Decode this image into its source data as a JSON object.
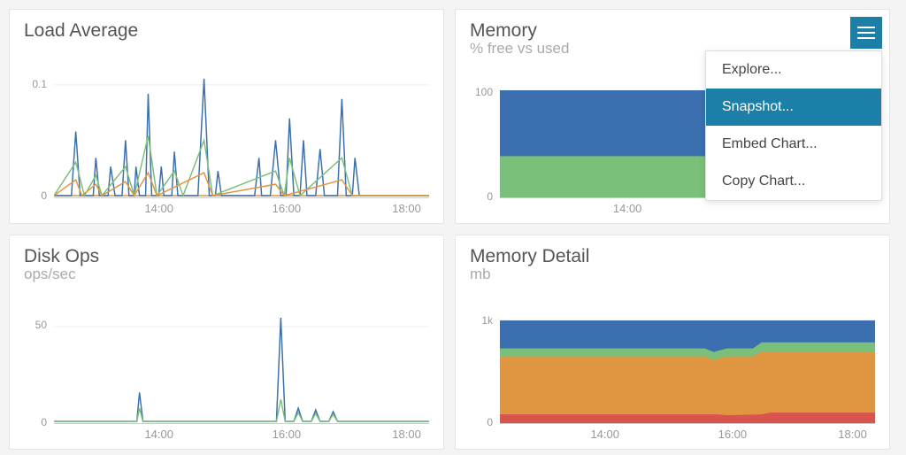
{
  "panels": {
    "load": {
      "title": "Load Average",
      "subtitle": ""
    },
    "memory": {
      "title": "Memory",
      "subtitle": "% free vs used"
    },
    "disk": {
      "title": "Disk Ops",
      "subtitle": "ops/sec"
    },
    "memdetail": {
      "title": "Memory Detail",
      "subtitle": "mb"
    }
  },
  "menu": {
    "items": [
      "Explore...",
      "Snapshot...",
      "Embed Chart...",
      "Copy Chart..."
    ],
    "selected": 1
  },
  "axes": {
    "load": {
      "y": [
        "0.1",
        "0"
      ],
      "x": [
        "14:00",
        "16:00",
        "18:00"
      ]
    },
    "memory": {
      "y": [
        "100",
        "0"
      ],
      "x": [
        "14:00"
      ]
    },
    "disk": {
      "y": [
        "50",
        "0"
      ],
      "x": [
        "14:00",
        "16:00",
        "18:00"
      ]
    },
    "memdetail": {
      "y": [
        "1k",
        "0"
      ],
      "x": [
        "14:00",
        "16:00",
        "18:00"
      ]
    }
  },
  "colors": {
    "blue": "#3b6fb0",
    "green": "#7ac07a",
    "orange": "#e09640",
    "red": "#d9534f",
    "accent": "#1b7fa8"
  },
  "chart_data": [
    {
      "id": "load",
      "type": "line",
      "title": "Load Average",
      "xlabel": "",
      "ylabel": "",
      "ylim": [
        0,
        0.12
      ],
      "x_ticks": [
        "14:00",
        "16:00",
        "18:00"
      ],
      "series": [
        {
          "name": "blue",
          "color": "#3b6fb0",
          "x": [
            12.8,
            13.0,
            13.2,
            13.4,
            13.5,
            13.6,
            13.7,
            13.8,
            14.5,
            14.6,
            15.4,
            15.6,
            15.7,
            15.8,
            16.0,
            16.4,
            16.5
          ],
          "y": [
            0.065,
            0.04,
            0.03,
            0.055,
            0.03,
            0.1,
            0.03,
            0.045,
            0.122,
            0.03,
            0.04,
            0.05,
            0.07,
            0.055,
            0.05,
            0.09,
            0.04
          ]
        },
        {
          "name": "green",
          "color": "#7ac07a",
          "x": [
            12.8,
            13.2,
            13.6,
            14.5,
            15.6,
            16.4
          ],
          "y": [
            0.035,
            0.02,
            0.05,
            0.06,
            0.03,
            0.04
          ]
        },
        {
          "name": "orange",
          "color": "#e09640",
          "x": [
            12.8,
            13.2,
            13.6,
            14.5,
            15.6,
            16.4
          ],
          "y": [
            0.02,
            0.01,
            0.025,
            0.03,
            0.015,
            0.02
          ]
        }
      ]
    },
    {
      "id": "memory",
      "type": "area",
      "title": "Memory",
      "subtitle": "% free vs used",
      "xlabel": "",
      "ylabel": "",
      "ylim": [
        0,
        100
      ],
      "x_range": [
        12.5,
        18.5
      ],
      "x_ticks": [
        "14:00"
      ],
      "series": [
        {
          "name": "used",
          "color": "#7ac07a",
          "value_pct": 40
        },
        {
          "name": "free",
          "color": "#3b6fb0",
          "value_pct": 60
        }
      ]
    },
    {
      "id": "disk",
      "type": "line",
      "title": "Disk Ops",
      "subtitle": "ops/sec",
      "xlabel": "",
      "ylabel": "",
      "ylim": [
        0,
        55
      ],
      "x_ticks": [
        "14:00",
        "16:00",
        "18:00"
      ],
      "series": [
        {
          "name": "blue",
          "color": "#3b6fb0",
          "x": [
            13.6,
            15.8,
            16.0,
            16.2,
            16.4
          ],
          "y": [
            15,
            50,
            8,
            6,
            5
          ]
        },
        {
          "name": "green",
          "color": "#7ac07a",
          "x": [
            13.6,
            15.8,
            16.0,
            16.2,
            16.4
          ],
          "y": [
            8,
            12,
            6,
            5,
            4
          ]
        }
      ]
    },
    {
      "id": "memdetail",
      "type": "area",
      "title": "Memory Detail",
      "subtitle": "mb",
      "xlabel": "",
      "ylabel": "",
      "ylim": [
        0,
        1000
      ],
      "x_range": [
        12.5,
        18.5
      ],
      "x_ticks": [
        "14:00",
        "16:00",
        "18:00"
      ],
      "series": [
        {
          "name": "red",
          "color": "#d9534f",
          "value": 80
        },
        {
          "name": "orange",
          "color": "#e09640",
          "value": 540
        },
        {
          "name": "green",
          "color": "#7ac07a",
          "value": 70
        },
        {
          "name": "blue",
          "color": "#3b6fb0",
          "value": 260
        }
      ]
    }
  ]
}
